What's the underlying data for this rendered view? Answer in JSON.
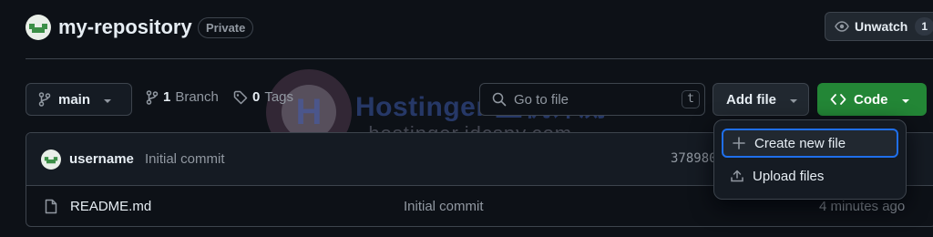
{
  "repo": {
    "name": "my-repository",
    "visibility": "Private"
  },
  "watch": {
    "label": "Unwatch",
    "count": "1"
  },
  "toolbar": {
    "branch": "main",
    "branch_count": "1",
    "branch_label": "Branch",
    "tag_count": "0",
    "tag_label": "Tags",
    "goto_placeholder": "Go to file",
    "goto_shortcut": "t",
    "add_file_label": "Add file",
    "code_label": "Code"
  },
  "add_file_menu": {
    "items": [
      {
        "label": "Create new file",
        "icon": "plus-icon"
      },
      {
        "label": "Upload files",
        "icon": "upload-icon"
      }
    ]
  },
  "latest_commit": {
    "user": "username",
    "message": "Initial commit",
    "hash": "378980"
  },
  "files": [
    {
      "name": "README.md",
      "commit_message": "Initial commit",
      "age": "4 minutes ago",
      "icon": "file-icon"
    }
  ],
  "watermark": {
    "title": "Hostinger 主机评测",
    "subtitle": "-hostinger.idcspy.com-"
  },
  "colors": {
    "background": "#0d1117",
    "border": "#3d444d",
    "code_button": "#238636",
    "focus_ring": "#1f6feb",
    "muted_text": "#9198a1"
  }
}
